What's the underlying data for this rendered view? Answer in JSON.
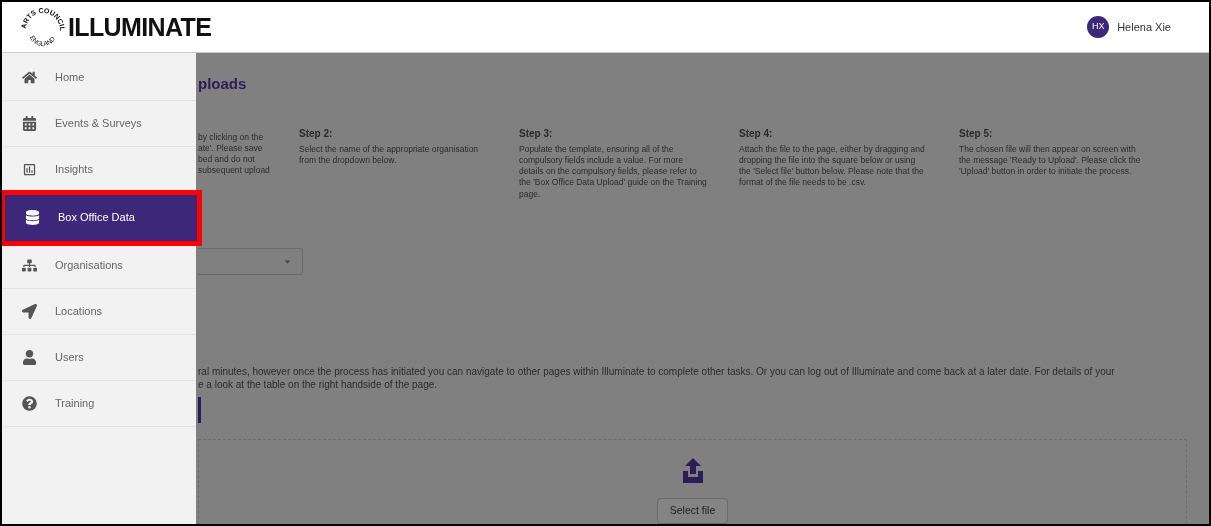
{
  "header": {
    "logo_ring_top": "ARTS COUNCIL",
    "logo_ring_bottom": "ENGLAND",
    "logo_text": "ILLUMINATE",
    "user": {
      "initials": "HX",
      "name": "Helena Xie"
    }
  },
  "sidebar": {
    "items": [
      {
        "kind": "home",
        "label": "Home",
        "selected": false,
        "highlighted": false
      },
      {
        "kind": "calendar",
        "label": "Events & Surveys",
        "selected": false,
        "highlighted": false
      },
      {
        "kind": "chart",
        "label": "Insights",
        "selected": false,
        "highlighted": false
      },
      {
        "kind": "database",
        "label": "Box Office Data",
        "selected": true,
        "highlighted": true
      },
      {
        "kind": "sitemap",
        "label": "Organisations",
        "selected": false,
        "highlighted": false
      },
      {
        "kind": "location",
        "label": "Locations",
        "selected": false,
        "highlighted": false
      },
      {
        "kind": "user",
        "label": "Users",
        "selected": false,
        "highlighted": false
      },
      {
        "kind": "help",
        "label": "Training",
        "selected": false,
        "highlighted": false
      }
    ]
  },
  "main": {
    "title": "ploads",
    "steps": [
      {
        "lines": [
          "by clicking on the",
          "ate'. Please save",
          "bed and do not",
          "subsequent upload"
        ]
      },
      {
        "heading": "Step 2:",
        "lines": [
          "Select the name of the appropriate organisation",
          "from the dropdown below."
        ]
      },
      {
        "heading": "Step 3:",
        "lines": [
          "Populate the template, ensuring all of the",
          "compulsory fields include a value. For more",
          "details on the compulsory fields, please refer to",
          "the 'Box Office Data Upload' guide on the Training",
          "page."
        ]
      },
      {
        "heading": "Step 4:",
        "lines": [
          "Attach the file to the page, either by dragging and",
          "dropping the file into the square below or using",
          "the 'Select file' button below. Please note that the",
          "format of the file needs to be .csv."
        ]
      },
      {
        "heading": "Step 5:",
        "lines": [
          "The chosen file will then appear on screen with",
          "the message 'Ready to Upload'. Please click the",
          "'Upload' button in order to initiate the process."
        ]
      }
    ],
    "notice_lines": [
      "ral minutes, however once the process has initiated you can navigate to other pages within Illuminate to complete other tasks. Or you can log out of Illuminate and come back at a later date. For details of your",
      "e a look at the table on the right handside of the page."
    ],
    "dropzone": {
      "button": "Select file"
    }
  }
}
